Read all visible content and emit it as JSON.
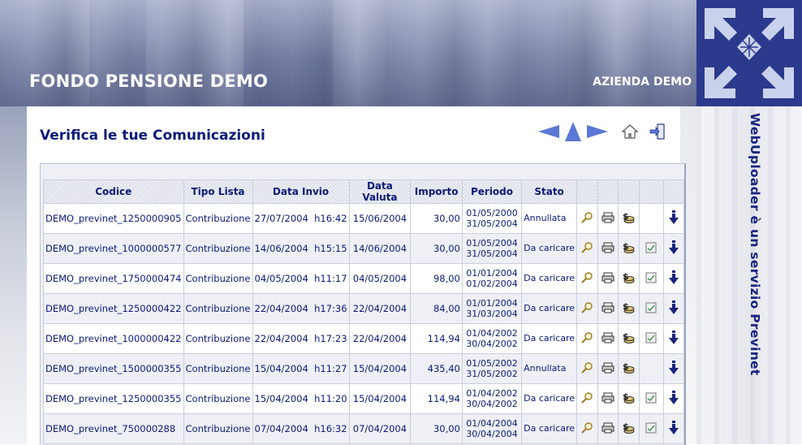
{
  "header": {
    "title": "FONDO PENSIONE DEMO",
    "company": "AZIENDA DEMO"
  },
  "sidebar": {
    "vertical_text": "WebUploader è un servizio Previnet"
  },
  "page": {
    "title": "Verifica le tue Comunicazioni"
  },
  "nav_icons": [
    "arrow-left-icon",
    "arrow-up-icon",
    "arrow-right-icon",
    "home-icon",
    "exit-icon"
  ],
  "colors": {
    "title_blue": "#0b1a7a",
    "nav_blue": "#5b78d6",
    "logo_bg": "#2b3a8c"
  },
  "table": {
    "headers": [
      "Codice",
      "Tipo Lista",
      "Data Invio",
      "Data Valuta",
      "Importo",
      "Periodo",
      "Stato"
    ],
    "rows": [
      {
        "codice": "DEMO_previnet_1250000905",
        "tipo": "Contribuzione",
        "invio_date": "27/07/2004",
        "invio_time": "h16:42",
        "valuta": "15/06/2004",
        "importo": "30,00",
        "p_from": "01/05/2000",
        "p_to": "31/05/2004",
        "stato": "Annullata",
        "has_doc": false
      },
      {
        "codice": "DEMO_previnet_1000000577",
        "tipo": "Contribuzione",
        "invio_date": "14/06/2004",
        "invio_time": "h15:15",
        "valuta": "14/06/2004",
        "importo": "30,00",
        "p_from": "01/05/2004",
        "p_to": "31/05/2004",
        "stato": "Da caricare",
        "has_doc": true
      },
      {
        "codice": "DEMO_previnet_1750000474",
        "tipo": "Contribuzione",
        "invio_date": "04/05/2004",
        "invio_time": "h11:17",
        "valuta": "04/05/2004",
        "importo": "98,00",
        "p_from": "01/01/2004",
        "p_to": "01/02/2004",
        "stato": "Da caricare",
        "has_doc": true
      },
      {
        "codice": "DEMO_previnet_1250000422",
        "tipo": "Contribuzione",
        "invio_date": "22/04/2004",
        "invio_time": "h17:36",
        "valuta": "22/04/2004",
        "importo": "84,00",
        "p_from": "01/01/2004",
        "p_to": "31/03/2004",
        "stato": "Da caricare",
        "has_doc": true
      },
      {
        "codice": "DEMO_previnet_1000000422",
        "tipo": "Contribuzione",
        "invio_date": "22/04/2004",
        "invio_time": "h17:23",
        "valuta": "22/04/2004",
        "importo": "114,94",
        "p_from": "01/04/2002",
        "p_to": "30/04/2002",
        "stato": "Da caricare",
        "has_doc": true
      },
      {
        "codice": "DEMO_previnet_1500000355",
        "tipo": "Contribuzione",
        "invio_date": "15/04/2004",
        "invio_time": "h11:27",
        "valuta": "15/04/2004",
        "importo": "435,40",
        "p_from": "01/05/2002",
        "p_to": "31/05/2002",
        "stato": "Annullata",
        "has_doc": false
      },
      {
        "codice": "DEMO_previnet_1250000355",
        "tipo": "Contribuzione",
        "invio_date": "15/04/2004",
        "invio_time": "h11:20",
        "valuta": "15/04/2004",
        "importo": "114,94",
        "p_from": "01/04/2002",
        "p_to": "30/04/2002",
        "stato": "Da caricare",
        "has_doc": true
      },
      {
        "codice": "DEMO_previnet_750000288",
        "tipo": "Contribuzione",
        "invio_date": "07/04/2004",
        "invio_time": "h16:32",
        "valuta": "07/04/2004",
        "importo": "30,00",
        "p_from": "01/04/2004",
        "p_to": "30/04/2004",
        "stato": "Da caricare",
        "has_doc": true
      }
    ],
    "row_icons": [
      "magnifier-icon",
      "print-icon",
      "money-icon",
      "document-icon",
      "download-arrow-icon"
    ]
  }
}
